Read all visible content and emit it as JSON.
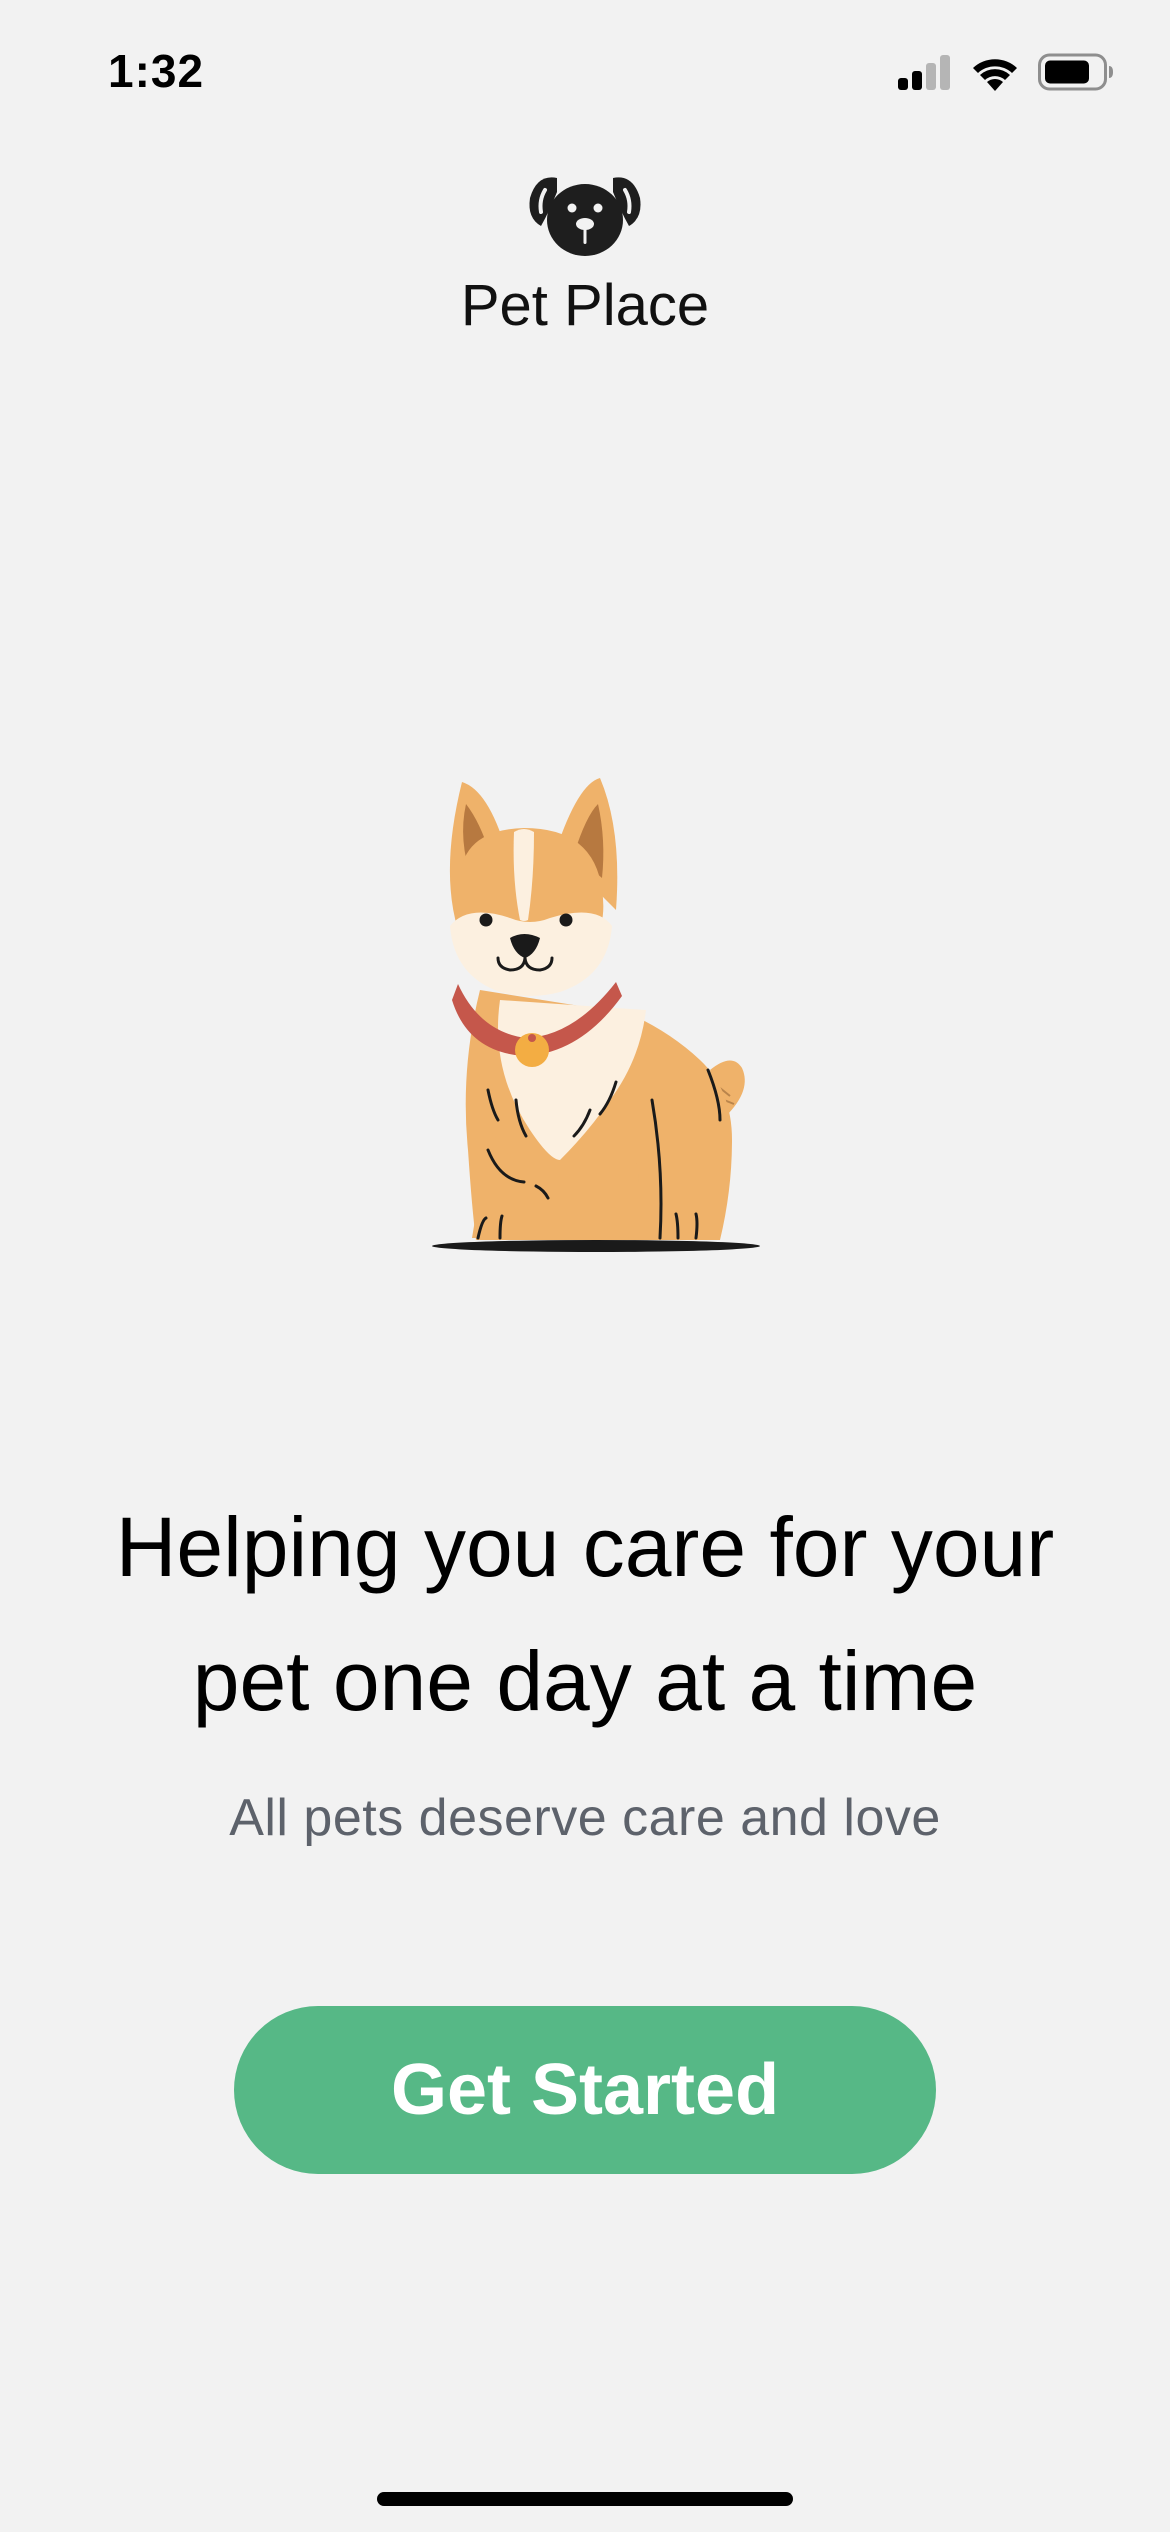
{
  "status_bar": {
    "time": "1:32",
    "icons": [
      "cellular-signal-icon",
      "wifi-icon",
      "battery-icon"
    ]
  },
  "brand": {
    "logo_icon": "dog-face-icon",
    "name": "Pet Place"
  },
  "hero": {
    "illustration": "corgi-illustration"
  },
  "headline": {
    "line1": "Helping you care for your",
    "line2": "pet one day at a time"
  },
  "subline": "All pets deserve care and love",
  "cta": {
    "label": "Get Started"
  },
  "colors": {
    "background": "#f2f2f2",
    "accent": "#56b886",
    "subtitle": "#5d626b",
    "corgi_fur": "#efb26a",
    "corgi_cream": "#fcf0e0",
    "collar": "#c5574b",
    "tag": "#f3ad43"
  }
}
